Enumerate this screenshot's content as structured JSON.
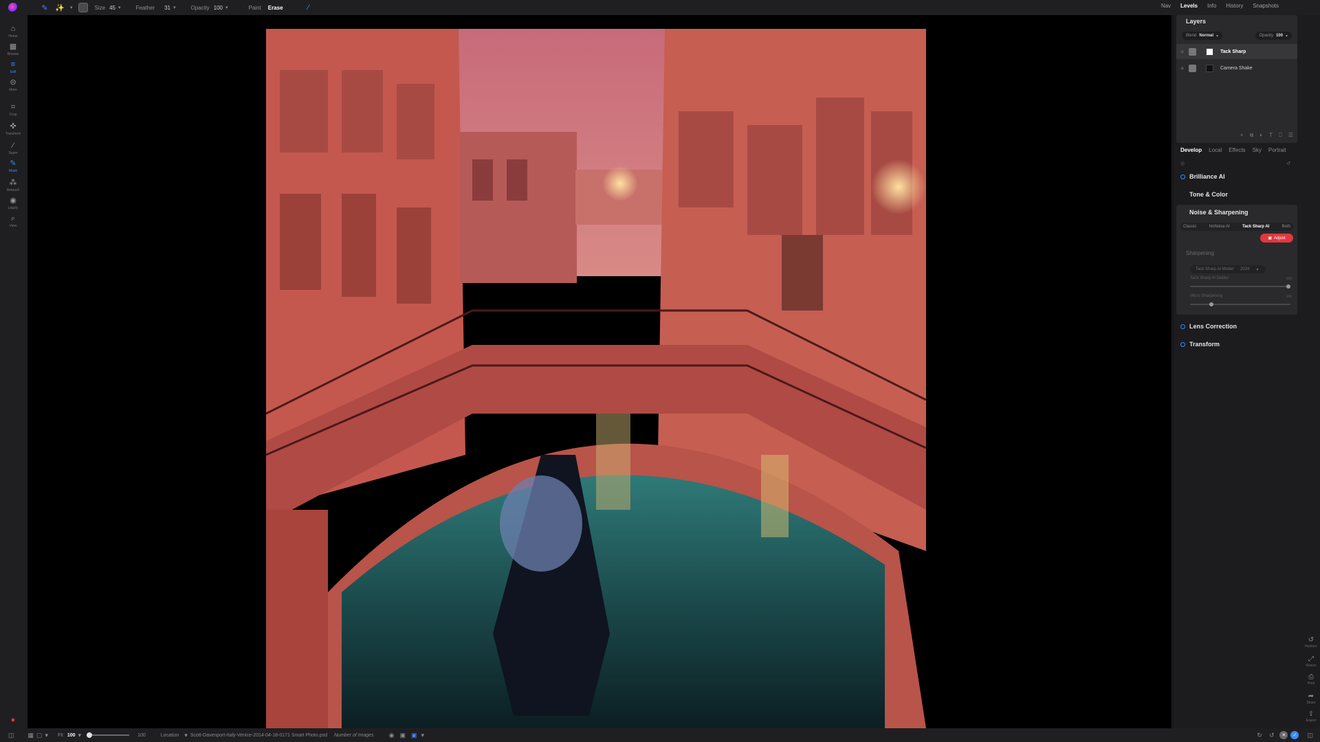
{
  "toolbar": {
    "size_label": "Size",
    "size_value": "45",
    "feather_label": "Feather",
    "feather_value": "31",
    "opacity_label": "Opacity",
    "opacity_value": "100",
    "paint_label": "Paint",
    "erase_label": "Erase"
  },
  "top_nav": {
    "nav": "Nav",
    "levels": "Levels",
    "info": "Info",
    "history": "History",
    "snapshots": "Snapshots"
  },
  "left_sidebar": {
    "items": [
      {
        "label": "Home",
        "icon": "home-icon"
      },
      {
        "label": "Browse",
        "icon": "grid-icon"
      },
      {
        "label": "Edit",
        "icon": "sliders-icon"
      },
      {
        "label": "More",
        "icon": "more-icon"
      },
      {
        "label": "Crop",
        "icon": "crop-icon"
      },
      {
        "label": "Transform",
        "icon": "move-icon"
      },
      {
        "label": "Super",
        "icon": "wand-icon"
      },
      {
        "label": "Mask",
        "icon": "brush-icon"
      },
      {
        "label": "Retouch",
        "icon": "bandage-icon"
      },
      {
        "label": "Liquify",
        "icon": "liquify-icon"
      },
      {
        "label": "View",
        "icon": "zoom-icon"
      }
    ]
  },
  "layers": {
    "title": "Layers",
    "blend_label": "Blend",
    "blend_value": "Normal",
    "opacity_label": "Opacity",
    "opacity_value": "100",
    "rows": [
      {
        "name": "Tack Sharp",
        "selected": true
      },
      {
        "name": "Camera Shake",
        "selected": false
      }
    ]
  },
  "develop": {
    "tabs": [
      "Develop",
      "Local",
      "Effects",
      "Sky",
      "Portrait"
    ],
    "sections": {
      "brilliance": "Brilliance AI",
      "tone": "Tone & Color",
      "noise": "Noise & Sharpening",
      "lens": "Lens Correction",
      "transform": "Transform"
    },
    "noise_modes": [
      "Classic",
      "NoNoise AI",
      "Tack Sharp AI",
      "Both"
    ],
    "adjust_label": "Adjust",
    "sharpening_title": "Sharpening",
    "model_label": "Tack Sharp AI Model",
    "model_value": "2024",
    "slider1_label": "Tack Sharp AI Deblur",
    "slider1_value": "100",
    "slider1_level": 1.0,
    "slider2_label": "Micro Sharpening",
    "slider2_value": "100",
    "slider2_level": 0.2
  },
  "right_actions": [
    "Restore",
    "Resize",
    "Print",
    "Share",
    "Export"
  ],
  "bottom": {
    "fit_label": "Fit",
    "zoom_value": "100",
    "zoom_max": "100",
    "location_label": "Location",
    "filename": "Scott-Davenport-Italy-Venice-2014-04-18-0171 Smart Photo.psd",
    "images_label": "Number of Images"
  },
  "colors": {
    "accent": "#3a8cff",
    "adjust_red": "#e0383e",
    "mask_overlay": "#ff5a4a"
  }
}
